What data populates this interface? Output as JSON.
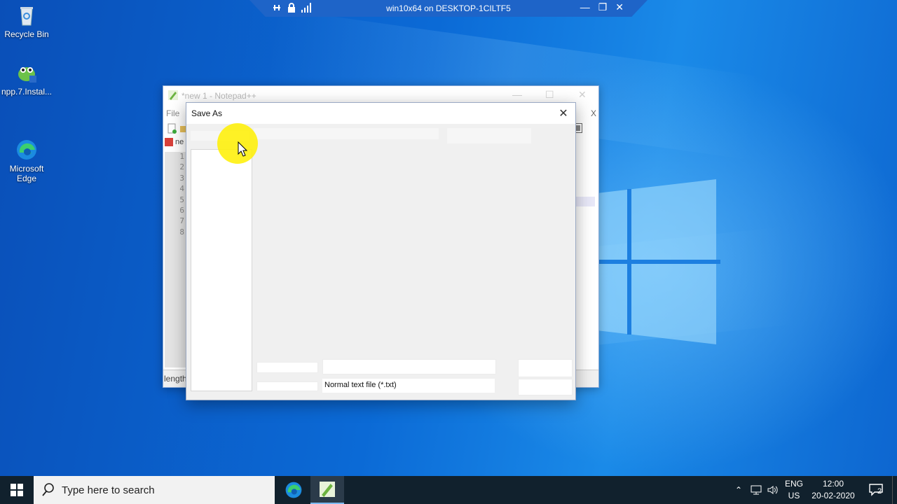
{
  "rdp": {
    "title": "win10x64 on DESKTOP-1CILTF5",
    "left_icons": [
      "pin-icon",
      "lock-icon",
      "signal-icon"
    ],
    "controls": [
      "minimize-icon",
      "restore-icon",
      "close-icon"
    ]
  },
  "desktop_icons": [
    {
      "label": "Recycle Bin",
      "icon": "recycle-bin-icon"
    },
    {
      "label": "npp.7.Instal...",
      "icon": "notepadpp-installer-icon"
    },
    {
      "label": "Microsoft\nEdge",
      "icon": "edge-icon"
    }
  ],
  "notepad": {
    "title": "*new 1 - Notepad++",
    "menu_file": "File",
    "close_doc": "X",
    "tab_label": "ne",
    "line_numbers": [
      "1",
      "2",
      "3",
      "4",
      "5",
      "6",
      "7",
      "8"
    ],
    "status": "length"
  },
  "dialog": {
    "title": "Save As",
    "save_as_type": "Normal text file (*.txt)"
  },
  "taskbar": {
    "search_placeholder": "Type here to search",
    "lang_top": "ENG",
    "lang_bottom": "US",
    "time": "12:00",
    "date": "20-02-2020",
    "notification_count": "2"
  },
  "colors": {
    "desktop": "#0b6ad6",
    "taskbar": "#11212d",
    "rdp_bar": "#1e64c8",
    "cursor_highlight": "#fff000"
  }
}
